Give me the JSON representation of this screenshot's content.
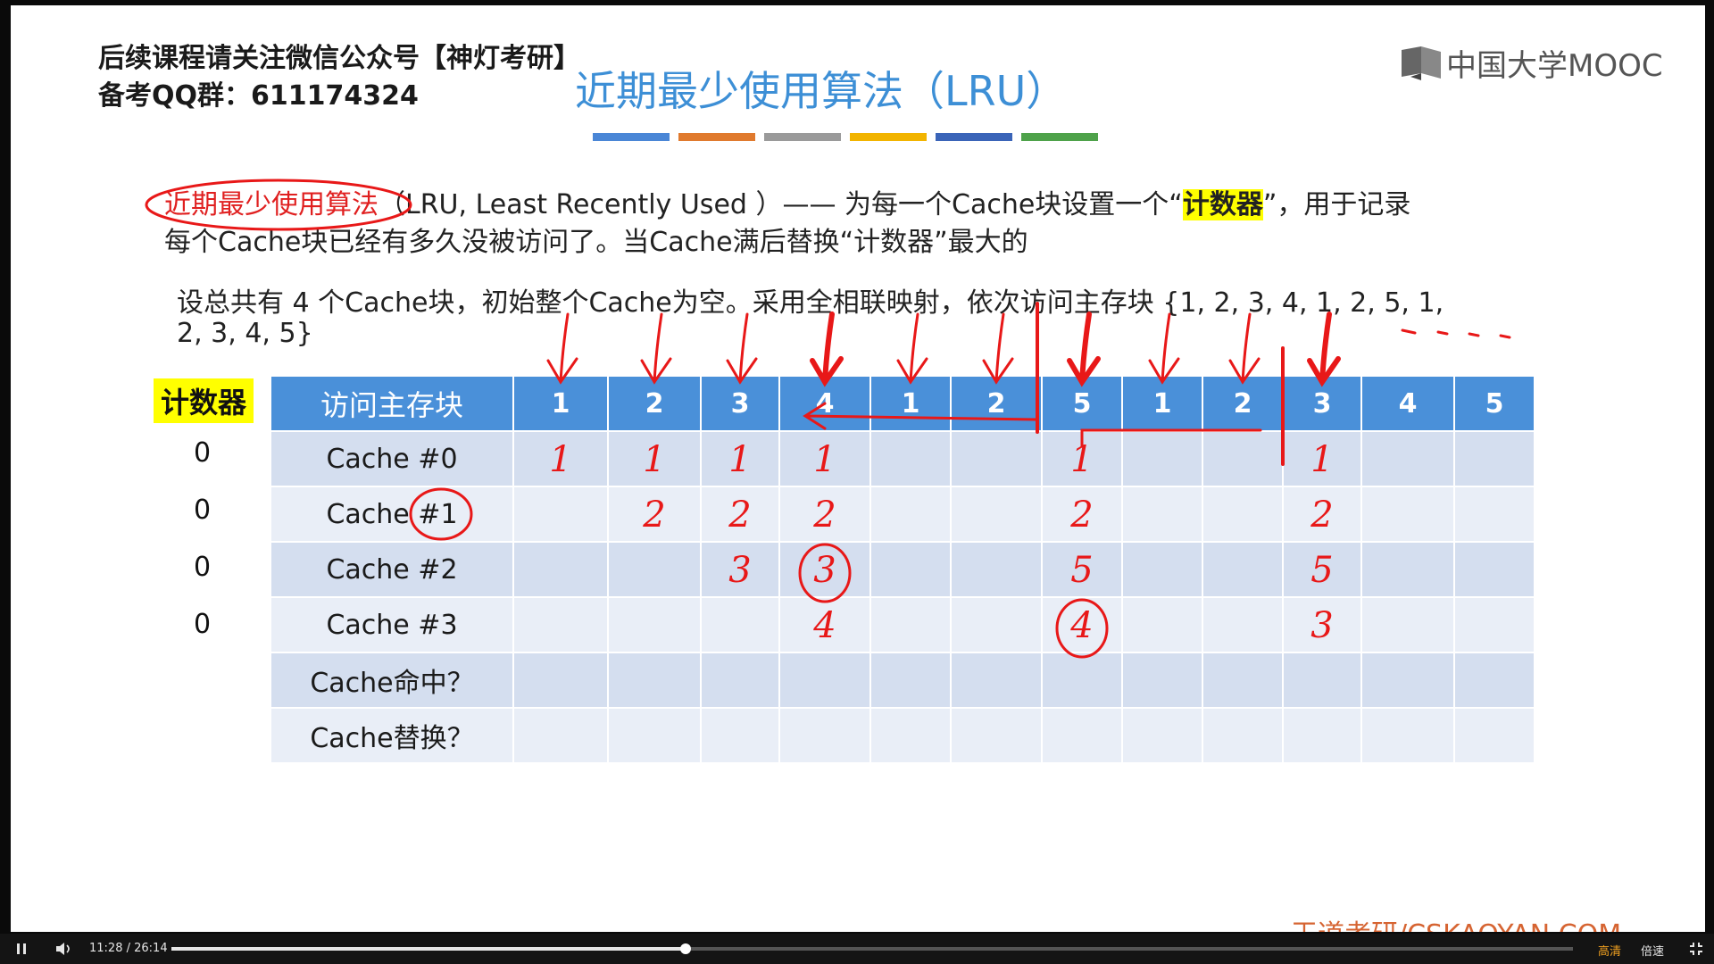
{
  "header": {
    "wechat": "后续课程请关注微信公众号【神灯考研】",
    "qq": "备考QQ群：611174324",
    "title": "近期最少使用算法（LRU）",
    "logo": "中国大学MOOC",
    "underline_colors": [
      "#4a86d6",
      "#e07a2e",
      "#9a9a9a",
      "#f2b400",
      "#3a64b8",
      "#4ea24a"
    ]
  },
  "definition": {
    "term": "近期最少使用算法",
    "part_a": "（LRU, Least Recently Used ）—— 为每一个Cache块设置一个“",
    "highlight": "计数器",
    "part_b": "”，用于记录",
    "line2": "每个Cache块已经有多久没被访问了。当Cache满后替换“计数器”最大的"
  },
  "question": {
    "line1": "设总共有 4 个Cache块，初始整个Cache为空。采用全相联映射，依次访问主存块 {1, 2, 3, 4, 1, 2, 5, 1,",
    "line2": "2, 3, 4, 5}"
  },
  "table": {
    "counter_header": "计数器",
    "header_label": "访问主存块",
    "accesses": [
      "1",
      "2",
      "3",
      "4",
      "1",
      "2",
      "5",
      "1",
      "2",
      "3",
      "4",
      "5"
    ],
    "rows": [
      {
        "label": "Cache #0",
        "counter": "0"
      },
      {
        "label": "Cache #1",
        "counter": "0"
      },
      {
        "label": "Cache #2",
        "counter": "0"
      },
      {
        "label": "Cache #3",
        "counter": "0"
      },
      {
        "label": "Cache命中？",
        "counter": ""
      },
      {
        "label": "Cache替换？",
        "counter": ""
      }
    ],
    "handwritten": [
      {
        "row": 0,
        "col": 0,
        "text": "1"
      },
      {
        "row": 0,
        "col": 1,
        "text": "1"
      },
      {
        "row": 0,
        "col": 2,
        "text": "1"
      },
      {
        "row": 0,
        "col": 3,
        "text": "1"
      },
      {
        "row": 0,
        "col": 6,
        "text": "1"
      },
      {
        "row": 0,
        "col": 9,
        "text": "1"
      },
      {
        "row": 1,
        "col": 1,
        "text": "2"
      },
      {
        "row": 1,
        "col": 2,
        "text": "2"
      },
      {
        "row": 1,
        "col": 3,
        "text": "2"
      },
      {
        "row": 1,
        "col": 6,
        "text": "2"
      },
      {
        "row": 1,
        "col": 9,
        "text": "2"
      },
      {
        "row": 2,
        "col": 2,
        "text": "3"
      },
      {
        "row": 2,
        "col": 3,
        "text": "3"
      },
      {
        "row": 2,
        "col": 6,
        "text": "5"
      },
      {
        "row": 2,
        "col": 9,
        "text": "5"
      },
      {
        "row": 3,
        "col": 3,
        "text": "4"
      },
      {
        "row": 3,
        "col": 6,
        "text": "4"
      },
      {
        "row": 3,
        "col": 9,
        "text": "3"
      }
    ],
    "circled": [
      {
        "row": 2,
        "col": 3
      },
      {
        "row": 3,
        "col": 6
      }
    ]
  },
  "watermark": "王道考研/CSKAOYAN.COM",
  "player": {
    "current_time": "11:28",
    "duration": "26:14",
    "progress": 0.3666,
    "quality": "高清",
    "speed": "倍速",
    "play_icon": "pause-icon",
    "volume_icon": "volume-icon",
    "fullscreen_icon": "exit-fullscreen-icon"
  }
}
